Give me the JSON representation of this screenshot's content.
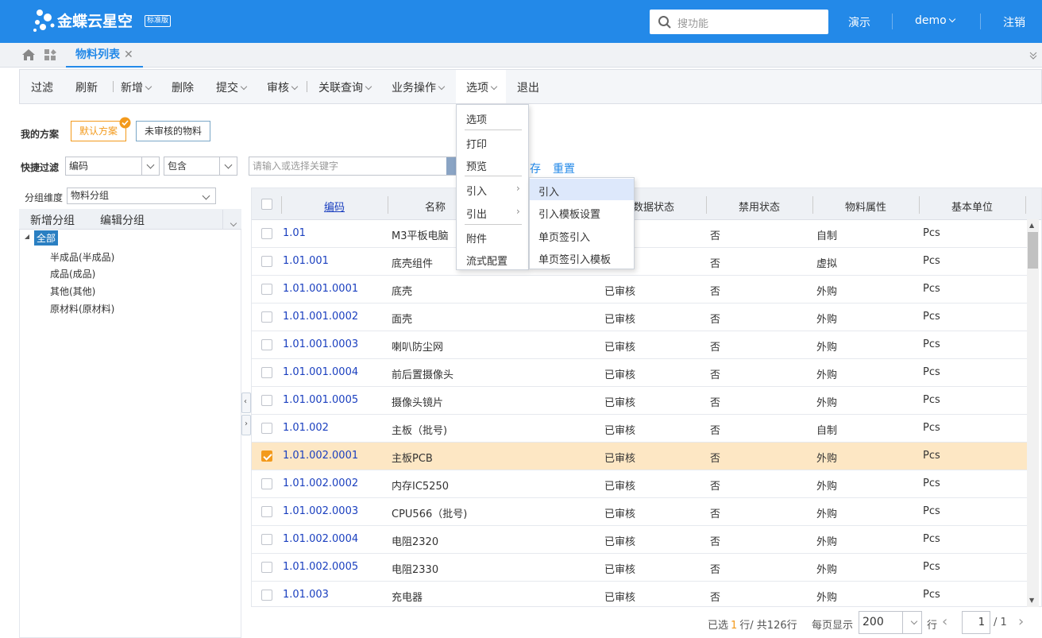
{
  "app": {
    "brand": "金蝶云星空",
    "edition": "标准版"
  },
  "header": {
    "search_placeholder": "搜功能",
    "nav_demo": "演示",
    "user": "demo",
    "logout": "注销"
  },
  "tabs": {
    "active": "物料列表"
  },
  "toolbar": {
    "filter": "过滤",
    "refresh": "刷新",
    "new": "新增",
    "delete": "删除",
    "submit": "提交",
    "audit": "审核",
    "related_query": "关联查询",
    "business_ops": "业务操作",
    "options": "选项",
    "exit": "退出"
  },
  "scheme": {
    "label": "我的方案",
    "default": "默认方案",
    "unaudited": "未审核的物料"
  },
  "quick_filter": {
    "label": "快捷过滤",
    "field": "编码",
    "operator": "包含",
    "keyword_placeholder": "请输入或选择关键字",
    "save": "存",
    "reset": "重置"
  },
  "group": {
    "label": "分组维度",
    "value": "物料分组",
    "add": "新增分组",
    "edit": "编辑分组"
  },
  "tree": {
    "root": "全部",
    "children": [
      "半成品(半成品)",
      "成品(成品)",
      "其他(其他)",
      "原材料(原材料)"
    ]
  },
  "grid": {
    "columns": [
      "编码",
      "名称",
      "数据状态",
      "禁用状态",
      "物料属性",
      "基本单位"
    ],
    "rows": [
      {
        "code": "1.01",
        "name": "M3平板电脑",
        "status": "",
        "disabled": "否",
        "attr": "自制",
        "unit": "Pcs",
        "checked": false
      },
      {
        "code": "1.01.001",
        "name": "底壳组件",
        "status": "",
        "disabled": "否",
        "attr": "虚拟",
        "unit": "Pcs",
        "checked": false
      },
      {
        "code": "1.01.001.0001",
        "name": "底壳",
        "status": "已审核",
        "disabled": "否",
        "attr": "外购",
        "unit": "Pcs",
        "checked": false
      },
      {
        "code": "1.01.001.0002",
        "name": "面壳",
        "status": "已审核",
        "disabled": "否",
        "attr": "外购",
        "unit": "Pcs",
        "checked": false
      },
      {
        "code": "1.01.001.0003",
        "name": "喇叭防尘网",
        "status": "已审核",
        "disabled": "否",
        "attr": "外购",
        "unit": "Pcs",
        "checked": false
      },
      {
        "code": "1.01.001.0004",
        "name": "前后置摄像头",
        "status": "已审核",
        "disabled": "否",
        "attr": "外购",
        "unit": "Pcs",
        "checked": false
      },
      {
        "code": "1.01.001.0005",
        "name": "摄像头镜片",
        "status": "已审核",
        "disabled": "否",
        "attr": "外购",
        "unit": "Pcs",
        "checked": false
      },
      {
        "code": "1.01.002",
        "name": "主板（批号)",
        "status": "已审核",
        "disabled": "否",
        "attr": "自制",
        "unit": "Pcs",
        "checked": false
      },
      {
        "code": "1.01.002.0001",
        "name": "主板PCB",
        "status": "已审核",
        "disabled": "否",
        "attr": "外购",
        "unit": "Pcs",
        "checked": true
      },
      {
        "code": "1.01.002.0002",
        "name": "内存IC5250",
        "status": "已审核",
        "disabled": "否",
        "attr": "外购",
        "unit": "Pcs",
        "checked": false
      },
      {
        "code": "1.01.002.0003",
        "name": "CPU566（批号)",
        "status": "已审核",
        "disabled": "否",
        "attr": "外购",
        "unit": "Pcs",
        "checked": false
      },
      {
        "code": "1.01.002.0004",
        "name": "电阻2320",
        "status": "已审核",
        "disabled": "否",
        "attr": "外购",
        "unit": "Pcs",
        "checked": false
      },
      {
        "code": "1.01.002.0005",
        "name": "电阻2330",
        "status": "已审核",
        "disabled": "否",
        "attr": "外购",
        "unit": "Pcs",
        "checked": false
      },
      {
        "code": "1.01.003",
        "name": "充电器",
        "status": "已审核",
        "disabled": "否",
        "attr": "外购",
        "unit": "Pcs",
        "checked": false
      }
    ]
  },
  "pager": {
    "selected_prefix": "已选",
    "selected": "1",
    "selected_suffix": "行/ 共126行",
    "per_page_label": "每页显示",
    "per_page": "200",
    "row_label": "行",
    "page": "1",
    "total_pages": "/ 1"
  },
  "options_menu": {
    "items": [
      "选项",
      "打印",
      "预览",
      "引入",
      "引出",
      "附件",
      "流式配置"
    ]
  },
  "import_submenu": {
    "items": [
      "引入",
      "引入模板设置",
      "单页签引入",
      "单页签引入模板"
    ]
  },
  "colors": {
    "brand": "#2389e8",
    "selected_row": "#fde7c4",
    "link": "#1a3fbf",
    "accent": "#f39a1c"
  }
}
